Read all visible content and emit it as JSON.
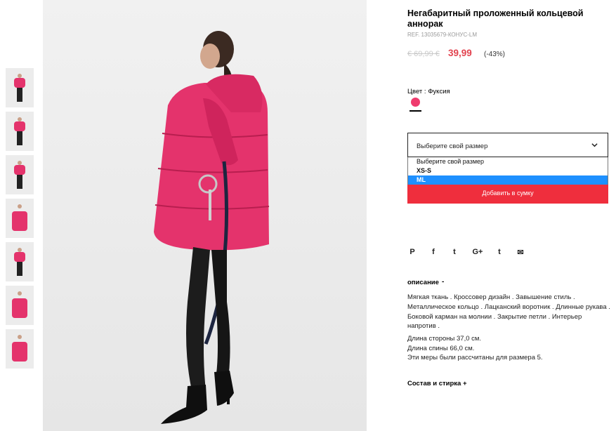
{
  "product": {
    "title": "Негабаритный проложенный кольцевой аннорак",
    "ref": "REF. 13035679-КОНУС-LM",
    "price_old": "€ 69,99 €",
    "price_new": "39,99",
    "discount": "(-43%)"
  },
  "color": {
    "label": "Цвет : Фуксия",
    "swatch_hex": "#ef3b6e"
  },
  "size_select": {
    "current": "Выберите свой размер",
    "options": [
      {
        "label": "Выберите свой размер",
        "selected": false
      },
      {
        "label": "XS-S",
        "selected": false
      },
      {
        "label": "ML",
        "selected": true
      }
    ]
  },
  "add_to_bag": "Добавить в сумку",
  "share_icons": [
    {
      "name": "pinterest-icon",
      "glyph": "P"
    },
    {
      "name": "facebook-icon",
      "glyph": "f"
    },
    {
      "name": "twitter-icon",
      "glyph": "t"
    },
    {
      "name": "google-plus-icon",
      "glyph": "G+"
    },
    {
      "name": "tumblr-icon",
      "glyph": "t"
    },
    {
      "name": "mail-icon",
      "glyph": "✉"
    }
  ],
  "description": {
    "heading": "описание",
    "toggle": "-",
    "text": "Мягкая ткань . Кроссовер дизайн . Завышение стиль . Металлическое кольцо . Лацканский воротник . Длинные рукава . Боковой карман на молнии . Закрытие петли . Интерьер напротив .",
    "measures": [
      "Длина стороны 37,0 см.",
      "Длина спины 66,0 см.",
      "Эти меры были рассчитаны для размера 5."
    ]
  },
  "composition": "Состав и стирка +",
  "colors": {
    "accent_red": "#ef2e3d",
    "price_red": "#e2434f",
    "jacket_pink": "#e4336c",
    "selected_blue": "#1e90ff"
  }
}
